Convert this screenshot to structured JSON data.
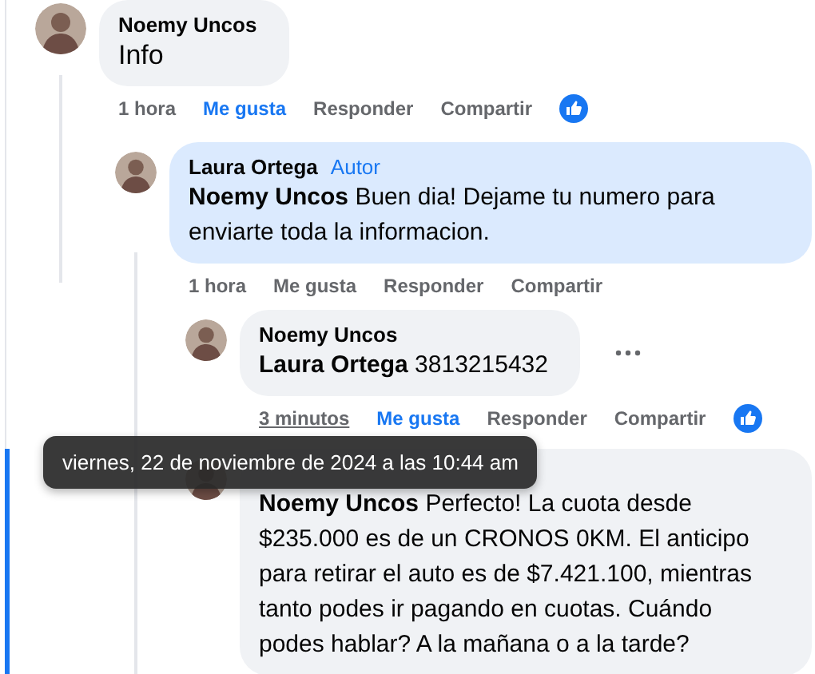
{
  "comments": [
    {
      "author": "Noemy Uncos",
      "text": "Info",
      "highlighted": false,
      "focused": false,
      "time": "1 hora",
      "like": {
        "label": "Me gusta",
        "selected": true
      },
      "reply": "Responder",
      "share": "Compartir",
      "reacted": true,
      "children": [
        {
          "author": "Laura Ortega",
          "badge": "Autor",
          "text": "**Noemy Uncos** Buen dia! Dejame tu numero para enviarte toda la informacion.",
          "highlighted": true,
          "focused": false,
          "time": "1 hora",
          "like": {
            "label": "Me gusta",
            "selected": false
          },
          "reply": "Responder",
          "share": "Compartir",
          "reacted": false,
          "children": [
            {
              "author": "Noemy Uncos",
              "text": "**Laura Ortega** 3813215432",
              "highlighted": false,
              "focused": false,
              "menu": true,
              "time": "3 minutos",
              "tooltip": "viernes, 22 de noviembre de 2024 a las 10:44 am",
              "like": {
                "label": "Me gusta",
                "selected": true
              },
              "reply": "Responder",
              "share": "Compartir",
              "reacted": true
            },
            {
              "text": "**Noemy Uncos** Perfecto! La cuota desde $235.000 es de un CRONOS 0KM. El anticipo para retirar el auto es de $7.421.100, mientras tanto podes ir pagando en cuotas. Cuándo podes hablar? A la mañana o a la tarde?",
              "highlighted": false,
              "focused": true
            }
          ]
        }
      ]
    }
  ]
}
